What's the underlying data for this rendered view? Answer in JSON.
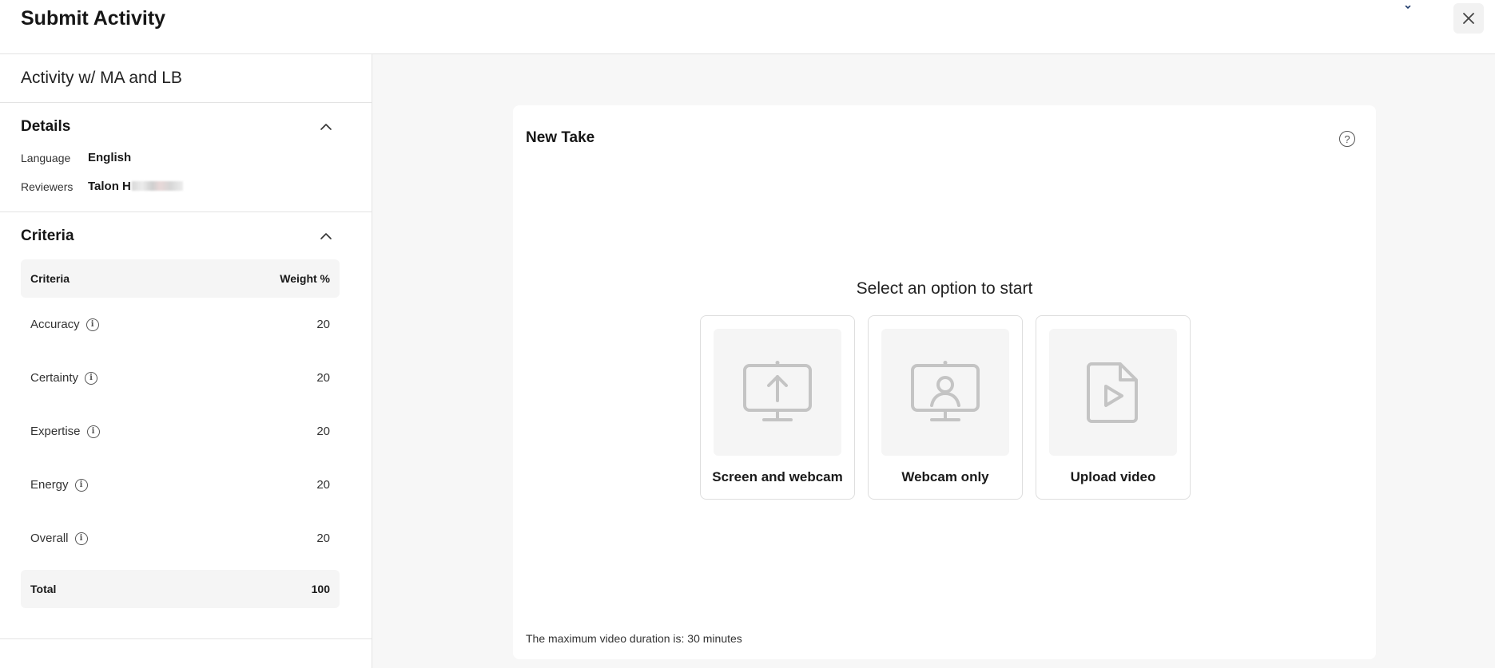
{
  "header": {
    "title": "Submit Activity",
    "close_icon": "close-icon"
  },
  "sidebar": {
    "activity_name": "Activity w/ MA and LB",
    "details": {
      "title": "Details",
      "rows": [
        {
          "key": "Language",
          "value": "English"
        },
        {
          "key": "Reviewers",
          "value": "Talon H"
        }
      ]
    },
    "criteria": {
      "title": "Criteria",
      "header": {
        "name": "Criteria",
        "weight": "Weight %"
      },
      "rows": [
        {
          "name": "Accuracy",
          "weight": "20"
        },
        {
          "name": "Certainty",
          "weight": "20"
        },
        {
          "name": "Expertise",
          "weight": "20"
        },
        {
          "name": "Energy",
          "weight": "20"
        },
        {
          "name": "Overall",
          "weight": "20"
        }
      ],
      "total": {
        "label": "Total",
        "value": "100"
      }
    }
  },
  "main": {
    "card_title": "New Take",
    "prompt": "Select an option to start",
    "options": [
      {
        "label": "Screen and webcam",
        "icon": "screen-upload-icon"
      },
      {
        "label": "Webcam only",
        "icon": "webcam-person-icon"
      },
      {
        "label": "Upload video",
        "icon": "video-file-icon"
      }
    ],
    "note": "The maximum video duration is: 30 minutes"
  },
  "colors": {
    "background": "#f7f7f7",
    "card": "#ffffff",
    "border": "#e3e3e3",
    "icon_gray": "#c4c4c4"
  }
}
